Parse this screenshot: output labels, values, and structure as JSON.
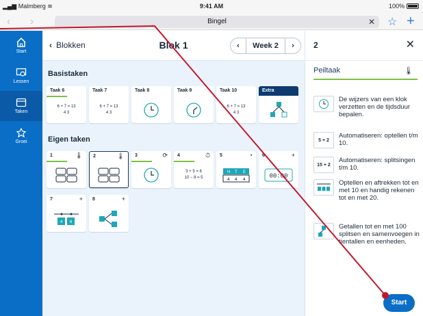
{
  "status": {
    "carrier": "Malmberg",
    "time": "9:41 AM",
    "battery": "100%"
  },
  "browser": {
    "back": "‹",
    "forward": "›",
    "title": "Bingel",
    "clear": "✕",
    "bookmark": "☆",
    "new_tab": "+"
  },
  "sidebar": {
    "items": [
      {
        "label": "Start",
        "icon": "home-icon"
      },
      {
        "label": "Lessen",
        "icon": "lessons-icon"
      },
      {
        "label": "Taken",
        "icon": "tasks-icon",
        "active": true
      },
      {
        "label": "Groei",
        "icon": "growth-icon"
      }
    ]
  },
  "header": {
    "back_label": "Blokken",
    "title": "Blok 1",
    "week": "Week 2",
    "prev": "‹",
    "next": "›"
  },
  "basistaken": {
    "title": "Basistaken",
    "tasks": [
      {
        "label": "Taak 6",
        "sum": "6 + 7 = 13",
        "parts": "4   3"
      },
      {
        "label": "Taak 7",
        "sum": "6 + 7 = 13",
        "parts": "4   3"
      },
      {
        "label": "Taak 8"
      },
      {
        "label": "Taak 9"
      },
      {
        "label": "Taak 10",
        "sum": "6 + 7 = 13",
        "parts": "4   3"
      },
      {
        "label": "Extra"
      }
    ]
  },
  "eigentaken": {
    "title": "Eigen taken",
    "tasks": [
      {
        "label": "1"
      },
      {
        "label": "2"
      },
      {
        "label": "3"
      },
      {
        "label": "4",
        "sum": "3 + 5 = 8",
        "sum2": "10 − 8 = 5"
      },
      {
        "label": "5",
        "htd": [
          "H",
          "T",
          "E"
        ],
        "vals": [
          "4",
          "4",
          "4"
        ]
      },
      {
        "label": "6",
        "time": "00:00"
      },
      {
        "label": "7",
        "vals": [
          "4",
          "6"
        ]
      },
      {
        "label": "8"
      }
    ]
  },
  "panel": {
    "number": "2",
    "close": "✕",
    "subtitle": "Peiltaak",
    "goals": [
      {
        "icon": "clock-icon",
        "text": "De wijzers van een klok verzetten en de tijdsduur bepalen."
      },
      {
        "icon_text": "5 + 2",
        "text": "Automatiseren: optellen t/m 10."
      },
      {
        "icon_text": "15 + 2",
        "text": "Automatiseren: splitsingen t/m 10."
      },
      {
        "icon": "numberline-icon",
        "text": "Optellen en aftrekken tot en met 10 en handig rekenen tot en met 20."
      },
      {
        "icon": "split-icon",
        "text": "Getallen tot en met 100 splitsen en samenvoegen in tientallen en eenheden."
      }
    ],
    "start_label": "Start"
  }
}
